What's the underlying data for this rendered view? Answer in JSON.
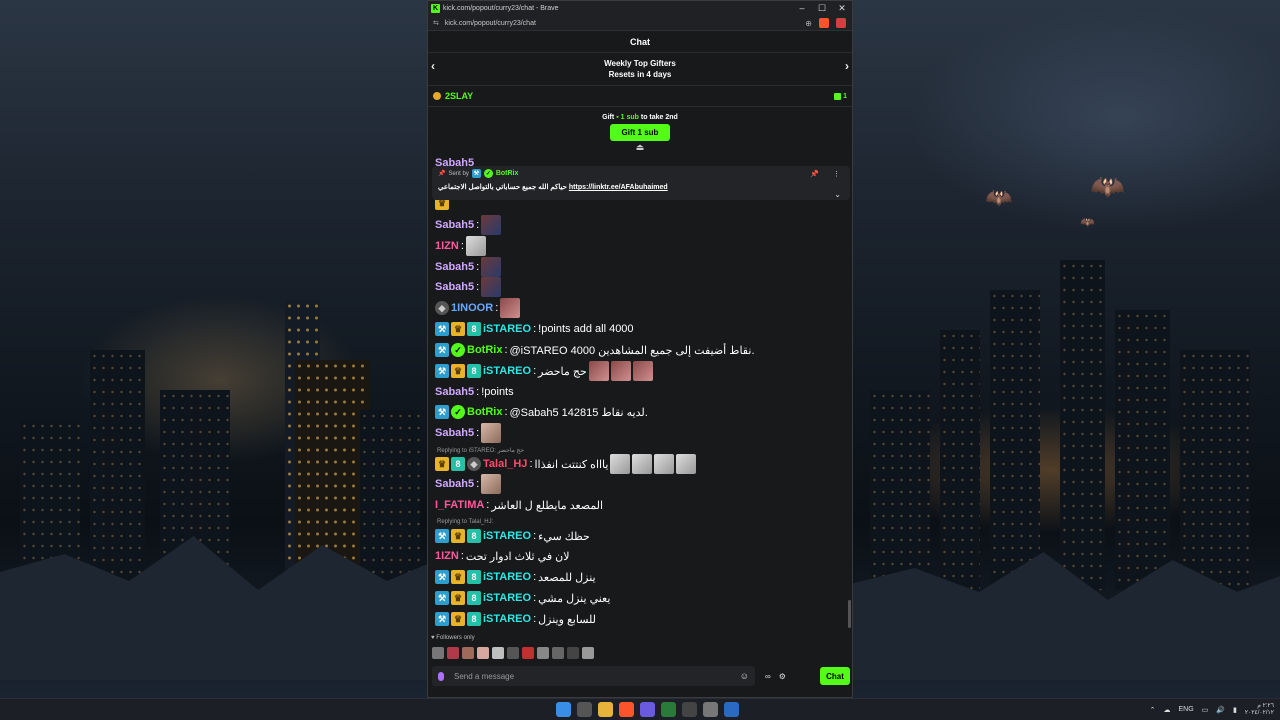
{
  "browser": {
    "title": "kick.com/popout/curry23/chat - Brave",
    "url": "kick.com/popout/curry23/chat",
    "brand_color": "#53fc18"
  },
  "chat": {
    "header": "Chat",
    "gifters_title": "Weekly Top Gifters",
    "gifters_sub": "Resets in 4 days",
    "top_gifter": "2SLAY",
    "top_gifter_count": "1",
    "gift_prefix": "Gift",
    "gift_amount": "1 sub",
    "gift_suffix": "to take 2nd",
    "gift_button": "Gift 1 sub",
    "partial_user": "Sabah5"
  },
  "pinned": {
    "sent_by": "Sent by",
    "sender": "BotRix",
    "text": "حياكم الله جميع حساباتي بالتواصل الاجتماعي",
    "link": "https://linktr.ee/AFAbuhaimed"
  },
  "messages": [
    {
      "user": "Sabah5",
      "text": ""
    },
    {
      "user": "1IZN",
      "text": ""
    },
    {
      "user": "Sabah5",
      "text": ""
    },
    {
      "user": "Sabah5",
      "text": ""
    },
    {
      "user": "1INOOR",
      "text": ""
    },
    {
      "user": "iSTAREO",
      "text": "!points add all 4000"
    },
    {
      "user": "BotRix",
      "text": "@iSTAREO 4000 نقاط أضيفت إلى جميع المشاهدين."
    },
    {
      "user": "iSTAREO",
      "text": "حج ماحضر"
    },
    {
      "user": "Sabah5",
      "text": "!points"
    },
    {
      "user": "BotRix",
      "text": "@Sabah5 142815 لديه نقاط."
    },
    {
      "user": "Sabah5",
      "text": ""
    },
    {
      "user": "Talal_HJ",
      "text": "ياااه كنتتت انفذاا"
    },
    {
      "user": "Sabah5",
      "text": ""
    },
    {
      "user": "I_FATIMA",
      "text": "المصعد مايطلع ل العاشر"
    },
    {
      "user": "iSTAREO",
      "text": "حظك سيء"
    },
    {
      "user": "1IZN",
      "text": "لان في ثلاث ادوار تحت"
    },
    {
      "user": "iSTAREO",
      "text": "ينزل للمصعد"
    },
    {
      "user": "iSTAREO",
      "text": "يعني ينزل مشي"
    },
    {
      "user": "iSTAREO",
      "text": "للسابع وينزل"
    }
  ],
  "replies": {
    "r1": "Replying to iSTAREO:",
    "r1_text": "حج ماحضر",
    "r2": "Replying to Talal_HJ:"
  },
  "footer": {
    "followers_only": "Followers only",
    "input_placeholder": "Send a message",
    "chat_button": "Chat"
  },
  "taskbar": {
    "lang": "ENG",
    "time": "٢:٢٦ م",
    "date": "٢٠٢٤/٠٢/١٢"
  }
}
